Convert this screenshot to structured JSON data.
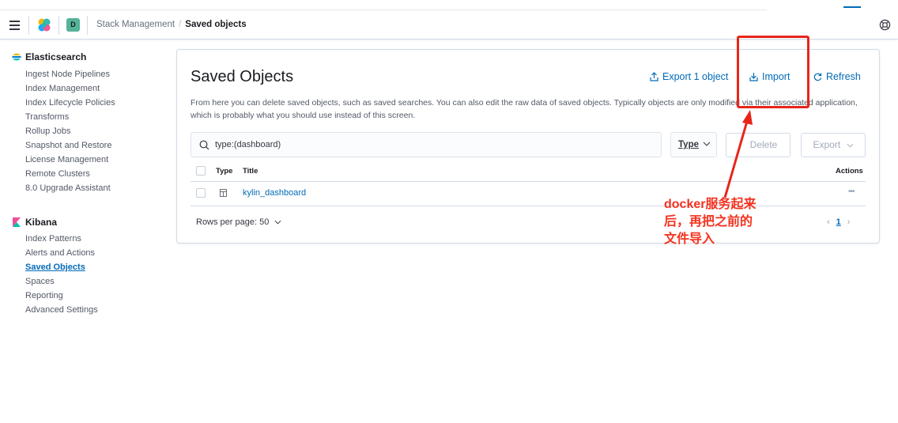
{
  "header": {
    "space_initial": "D",
    "breadcrumbs": [
      "Stack Management",
      "Saved objects"
    ]
  },
  "sidebar": {
    "sections": [
      {
        "title": "Elasticsearch",
        "items": [
          "Ingest Node Pipelines",
          "Index Management",
          "Index Lifecycle Policies",
          "Transforms",
          "Rollup Jobs",
          "Snapshot and Restore",
          "License Management",
          "Remote Clusters",
          "8.0 Upgrade Assistant"
        ]
      },
      {
        "title": "Kibana",
        "items": [
          "Index Patterns",
          "Alerts and Actions",
          "Saved Objects",
          "Spaces",
          "Reporting",
          "Advanced Settings"
        ]
      }
    ],
    "active_item": "Saved Objects"
  },
  "main": {
    "title": "Saved Objects",
    "export_label": "Export 1 object",
    "import_label": "Import",
    "refresh_label": "Refresh",
    "description": "From here you can delete saved objects, such as saved searches. You can also edit the raw data of saved objects. Typically objects are only modified via their associated application, which is probably what you should use instead of this screen.",
    "search_value": "type:(dashboard)",
    "type_filter_label": "Type",
    "delete_label": "Delete",
    "export_button_label": "Export",
    "columns": [
      "Type",
      "Title",
      "Actions"
    ],
    "rows": [
      {
        "type_icon": "dashboard-icon",
        "title": "kylin_dashboard"
      }
    ],
    "rows_per_page": "Rows per page: 50",
    "current_page": "1"
  },
  "annotation": {
    "text": "docker服务起来后，再把之前的文件导入",
    "color": "#f4321f"
  }
}
